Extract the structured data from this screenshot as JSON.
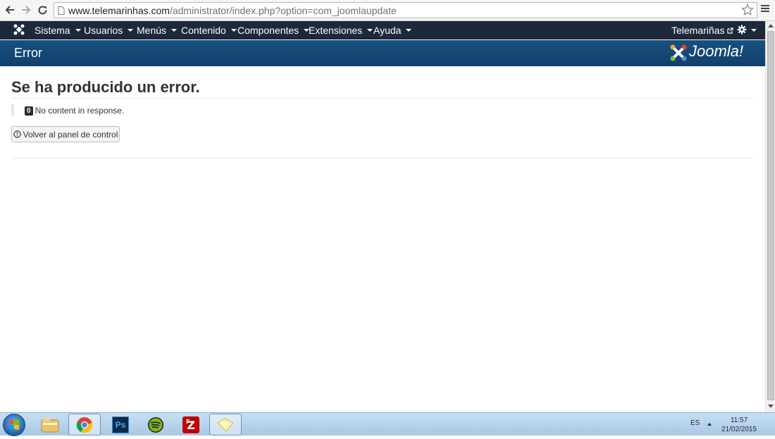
{
  "browser": {
    "url_host": "www.telemarinhas.com",
    "url_path": "/administrator/index.php?option=com_joomlaupdate"
  },
  "navbar": {
    "items": [
      {
        "label": "Sistema"
      },
      {
        "label": "Usuarios"
      },
      {
        "label": "Menús"
      },
      {
        "label": "Contenido"
      },
      {
        "label": "Componentes"
      },
      {
        "label": "Extensiones"
      },
      {
        "label": "Ayuda"
      }
    ],
    "site_link": "Telemariñas"
  },
  "header": {
    "title": "Error",
    "logo_text": "Joomla!"
  },
  "error": {
    "heading": "Se ha producido un error.",
    "code": "0",
    "message": "No content in response.",
    "back_button": "Volver al panel de control"
  },
  "taskbar": {
    "apps": [
      "windows-explorer-icon",
      "chrome-icon",
      "photoshop-icon",
      "spotify-icon",
      "filezilla-icon",
      "sticky-notes-icon"
    ],
    "photoshop_label": "Ps",
    "language": "ES",
    "time": "11:57",
    "date": "21/02/2015"
  }
}
